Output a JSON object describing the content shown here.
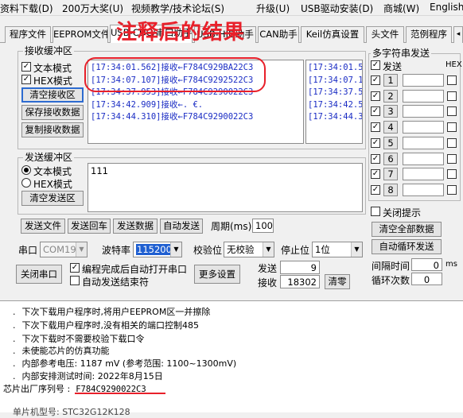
{
  "menu": [
    "资料下载(D)",
    "200万大奖(U)",
    "视频教学/技术论坛(S)",
    "升级(U)",
    "USB驱动安装(D)",
    "商城(W)",
    "English"
  ],
  "tabs": [
    "程序文件",
    "EEPROM文件",
    "USB-CDC/串口助手",
    "USB-HID助手",
    "CAN助手",
    "Keil仿真设置",
    "头文件",
    "范例程序"
  ],
  "annotation": "注释后的结果",
  "recv": {
    "title": "接收缓冲区",
    "text_mode": "文本模式",
    "hex_mode": "HEX模式",
    "clear": "清空接收区",
    "save": "保存接收数据",
    "copy": "复制接收数据",
    "lines": [
      "[17:34:01.562]接收←F784C929BA22C3",
      "[17:34:07.107]接收←F784C9292522C3",
      "[17:34:37.953]接收←F784C9290022C3",
      "[17:34:42.909]接收←. €.",
      "[17:34:44.310]接收←F784C9290022C3"
    ],
    "side_lines": [
      "[17:34:01.5",
      "[17:34:07.1",
      "[17:34:37.5",
      "[17:34:42.5",
      "[17:34:44.3"
    ]
  },
  "send": {
    "title": "发送缓冲区",
    "text_mode": "文本模式",
    "hex_mode": "HEX模式",
    "clear": "清空发送区",
    "content": "111"
  },
  "actions": [
    "发送文件",
    "发送回车",
    "发送数据",
    "自动发送"
  ],
  "period_label": "周期(ms)",
  "period": "100",
  "port": {
    "label": "串口",
    "value": "COM19",
    "baud_label": "波特率",
    "baud": "115200",
    "parity_label": "校验位",
    "parity": "无校验",
    "stop_label": "停止位",
    "stop": "1位"
  },
  "close_port": "关闭串口",
  "auto_open": "编程完成后自动打开串口",
  "auto_recv": "自动发送结束符",
  "more": "更多设置",
  "counters": {
    "send_label": "发送",
    "send": "9",
    "recv_label": "接收",
    "recv": "18302",
    "clear": "清零"
  },
  "multi": {
    "title": "多字符串发送",
    "send": "发送",
    "hex": "HEX",
    "rows": [
      "1",
      "2",
      "3",
      "4",
      "5",
      "6",
      "7",
      "8"
    ],
    "close_tip": "关闭提示",
    "clear_all": "清空全部数据",
    "auto_loop": "自动循环发送",
    "interval_label": "间隔时间",
    "interval": "0",
    "ms": "ms",
    "loop_label": "循环次数",
    "loop": "0"
  },
  "log": [
    "下次下载用户程序时,将用户EEPROM区一并擦除",
    "下次下载用户程序时,没有相关的端口控制485",
    "下次下载时不需要校验下载口令",
    "未使能芯片的仿真功能",
    "内部参考电压: 1187 mV (参考范围: 1100~1300mV)",
    "内部安排测试时间: 2022年8月15日"
  ],
  "serial_label": "芯片出厂序列号 :",
  "serial": "F784C9290022C3",
  "last_line": "单片机型号: STC32G12K128",
  "colors": {
    "annotation": "#e8202a",
    "recv_text": "#1a2cc4",
    "highlight": "#e8202a"
  }
}
